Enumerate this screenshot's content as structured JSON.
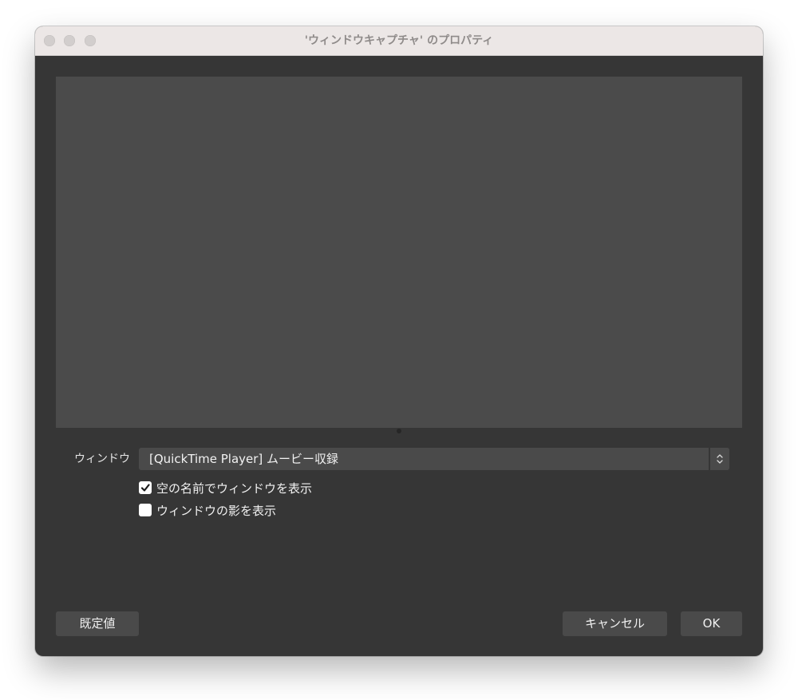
{
  "window": {
    "title": "'ウィンドウキャプチャ' のプロパティ"
  },
  "form": {
    "window_label": "ウィンドウ",
    "window_select_value": "[QuickTime Player] ムービー収録",
    "checkboxes": [
      {
        "label": "空の名前でウィンドウを表示",
        "checked": true
      },
      {
        "label": "ウィンドウの影を表示",
        "checked": false
      }
    ]
  },
  "buttons": {
    "defaults": "既定値",
    "cancel": "キャンセル",
    "ok": "OK"
  },
  "colors": {
    "window_bg": "#363636",
    "preview_bg": "#4b4b4b",
    "titlebar_bg": "#ece7e6",
    "control_bg": "#4a4a4a"
  }
}
